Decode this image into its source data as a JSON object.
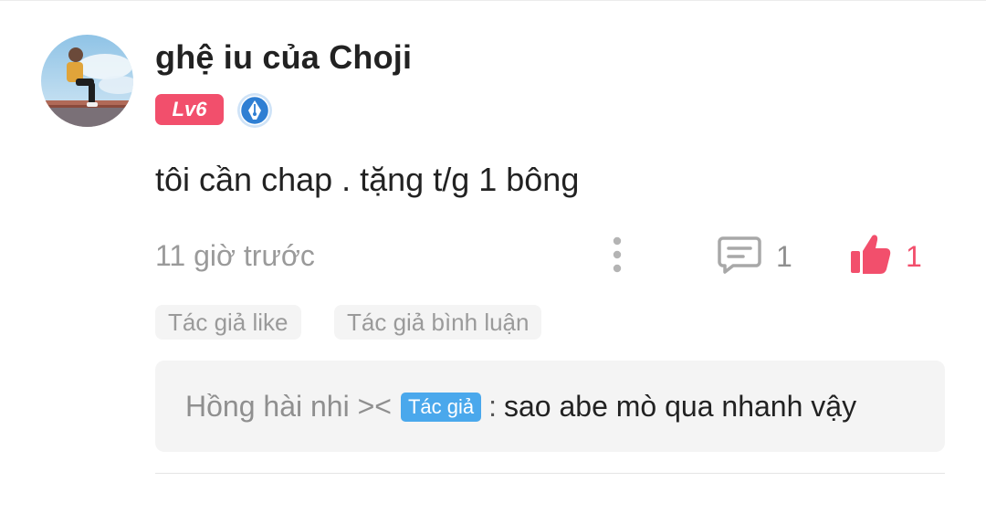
{
  "comment": {
    "username": "ghệ iu của Choji",
    "level": "Lv6",
    "text": "tôi cần chap . tặng t/g 1 bông",
    "time": "11 giờ trước",
    "reply_count": "1",
    "like_count": "1",
    "icons": {
      "avatar": "user-avatar",
      "writer_badge": "pen-nib-icon",
      "more": "more-vertical-icon",
      "reply": "comment-icon",
      "like": "thumbs-up-icon"
    }
  },
  "author_tags": [
    "Tác giả like",
    "Tác giả bình luận"
  ],
  "reply": {
    "author": "Hồng hài nhi ><",
    "author_badge": "Tác giả",
    "separator": ":",
    "text": "sao abe mò qua nhanh vậy"
  },
  "colors": {
    "accent": "#f24f6c",
    "author_badge": "#4aa8ec",
    "muted_text": "#9a9a9a",
    "tag_background": "#f4f4f4"
  }
}
